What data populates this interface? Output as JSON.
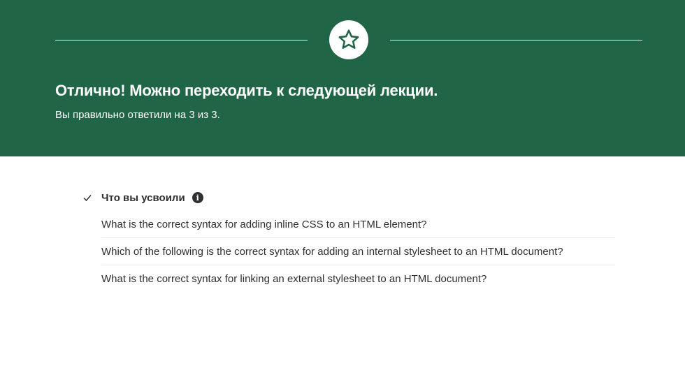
{
  "banner": {
    "title": "Отлично! Можно переходить к следующей лекции.",
    "subtitle": "Вы правильно ответили на 3 из 3.",
    "icon": "star-icon",
    "background_color": "#206546"
  },
  "learned": {
    "title": "Что вы усвоили",
    "info_icon_glyph": "i",
    "questions": [
      "What is the correct syntax for adding inline CSS to an HTML element?",
      "Which of the following is the correct syntax for adding an internal stylesheet to an HTML document?",
      "What is the correct syntax for linking an external stylesheet to an HTML document?"
    ]
  }
}
